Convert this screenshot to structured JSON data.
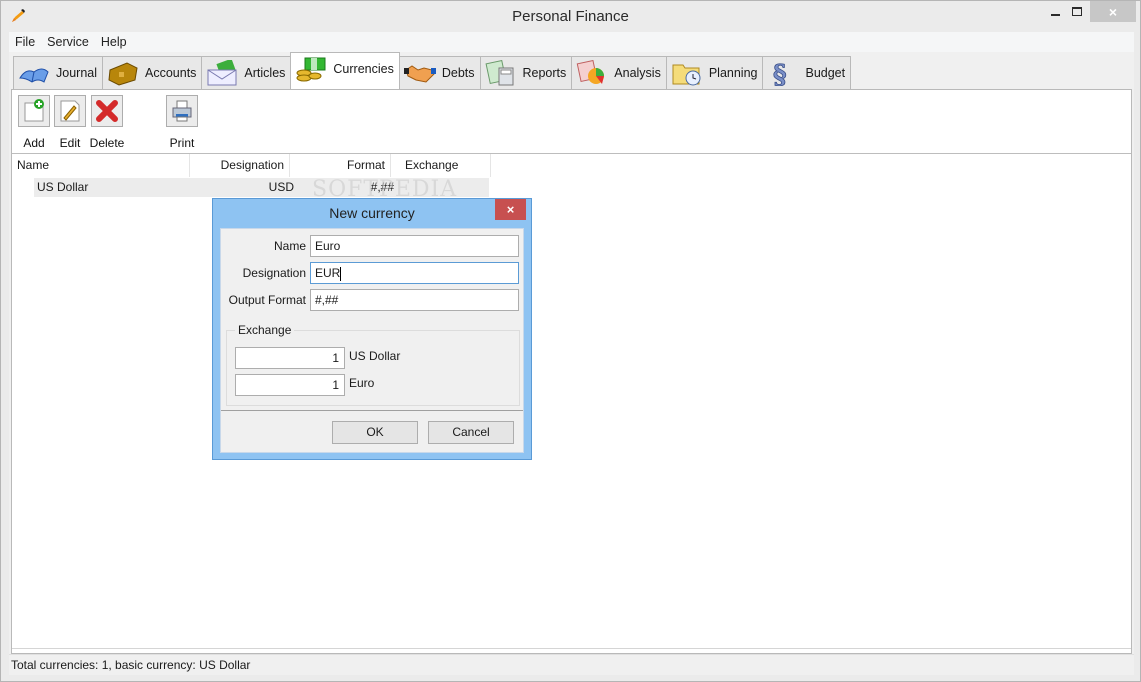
{
  "window": {
    "title": "Personal Finance",
    "controls": {
      "minimize": "minimize",
      "maximize": "maximize",
      "close": "×"
    }
  },
  "menu": [
    "File",
    "Service",
    "Help"
  ],
  "tabs": [
    {
      "label": "Journal",
      "icon": "book-icon",
      "active": false
    },
    {
      "label": "Accounts",
      "icon": "wallet-icon",
      "active": false
    },
    {
      "label": "Articles",
      "icon": "envelope-money-icon",
      "active": false
    },
    {
      "label": "Currencies",
      "icon": "money-coins-icon",
      "active": true
    },
    {
      "label": "Debts",
      "icon": "handshake-icon",
      "active": false
    },
    {
      "label": "Reports",
      "icon": "calculator-report-icon",
      "active": false
    },
    {
      "label": "Analysis",
      "icon": "pie-chart-icon",
      "active": false
    },
    {
      "label": "Planning",
      "icon": "folder-clock-icon",
      "active": false
    },
    {
      "label": "Budget",
      "icon": "section-sign-icon",
      "active": false
    }
  ],
  "toolbar": {
    "add": "Add",
    "edit": "Edit",
    "delete": "Delete",
    "print": "Print"
  },
  "grid": {
    "columns": [
      "Name",
      "Designation",
      "Format",
      "Exchange rates"
    ],
    "rows": [
      {
        "name": "US Dollar",
        "designation": "USD",
        "format": "#,##",
        "exchange_rates": ""
      }
    ]
  },
  "watermark": "SOFTPEDIA",
  "status": "Total currencies: 1, basic currency: US Dollar",
  "dialog": {
    "title": "New currency",
    "close": "×",
    "fields": {
      "name_label": "Name",
      "name_value": "Euro",
      "designation_label": "Designation",
      "designation_value": "EUR",
      "format_label": "Output Format",
      "format_value": "#,##"
    },
    "exchange": {
      "legend": "Exchange",
      "rows": [
        {
          "value": "1",
          "currency": "US Dollar"
        },
        {
          "value": "1",
          "currency": "Euro"
        }
      ]
    },
    "ok": "OK",
    "cancel": "Cancel"
  }
}
